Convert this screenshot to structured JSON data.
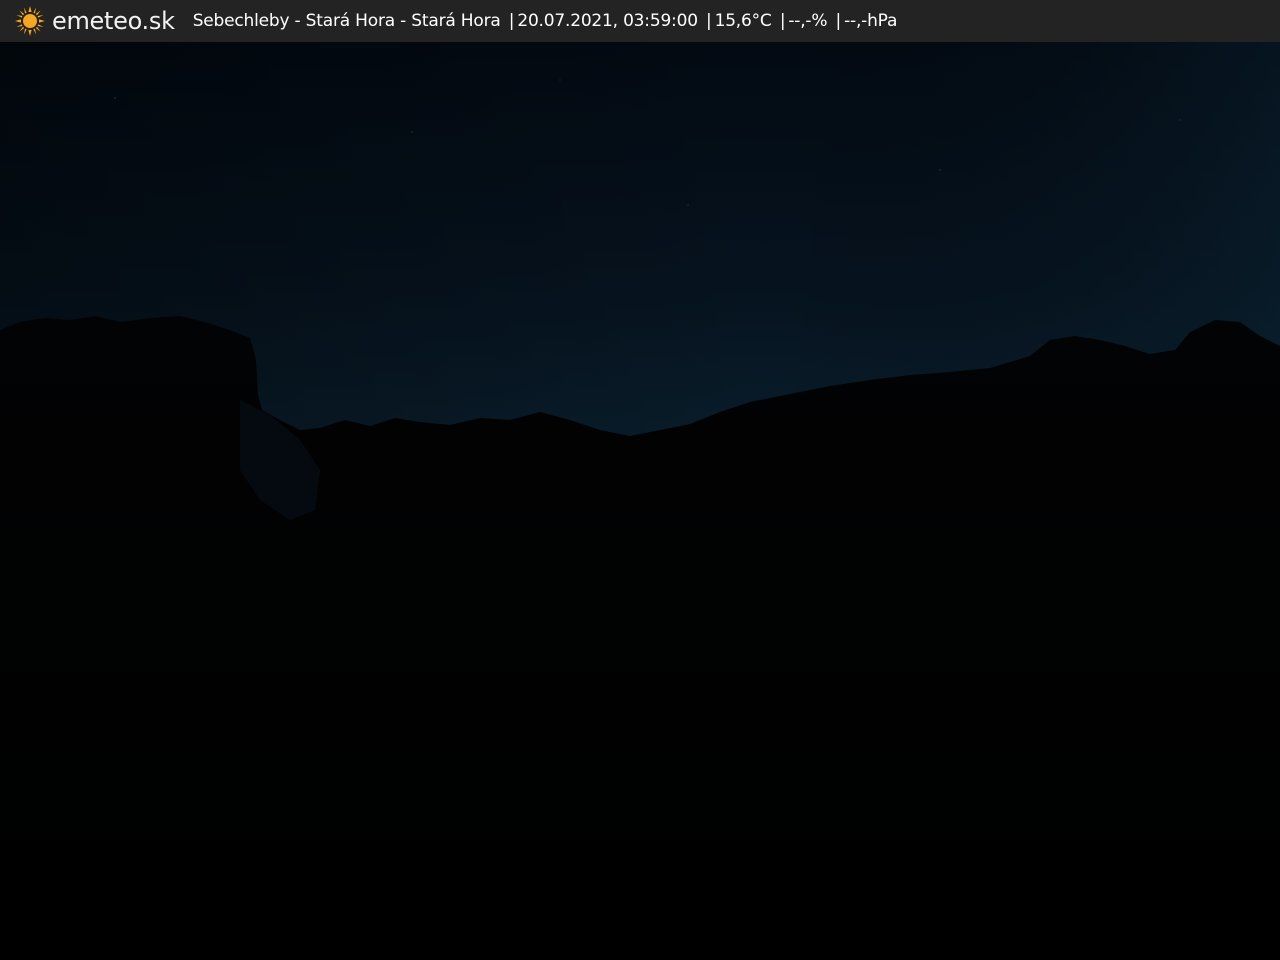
{
  "header": {
    "brand": "emeteo.sk",
    "logo_icon": "sun-icon",
    "location": "Sebechleby - Stará Hora - Stará Hora",
    "datetime": "20.07.2021, 03:59:00",
    "temperature": "15,6°C",
    "humidity": "--,-%",
    "pressure": "--,-hPa",
    "separator": "|"
  },
  "colors": {
    "bar_background": "#242424",
    "sun": "#f5a623",
    "sky_top": "#020810",
    "sky_horizon": "#0a2233",
    "ground": "#010101"
  }
}
